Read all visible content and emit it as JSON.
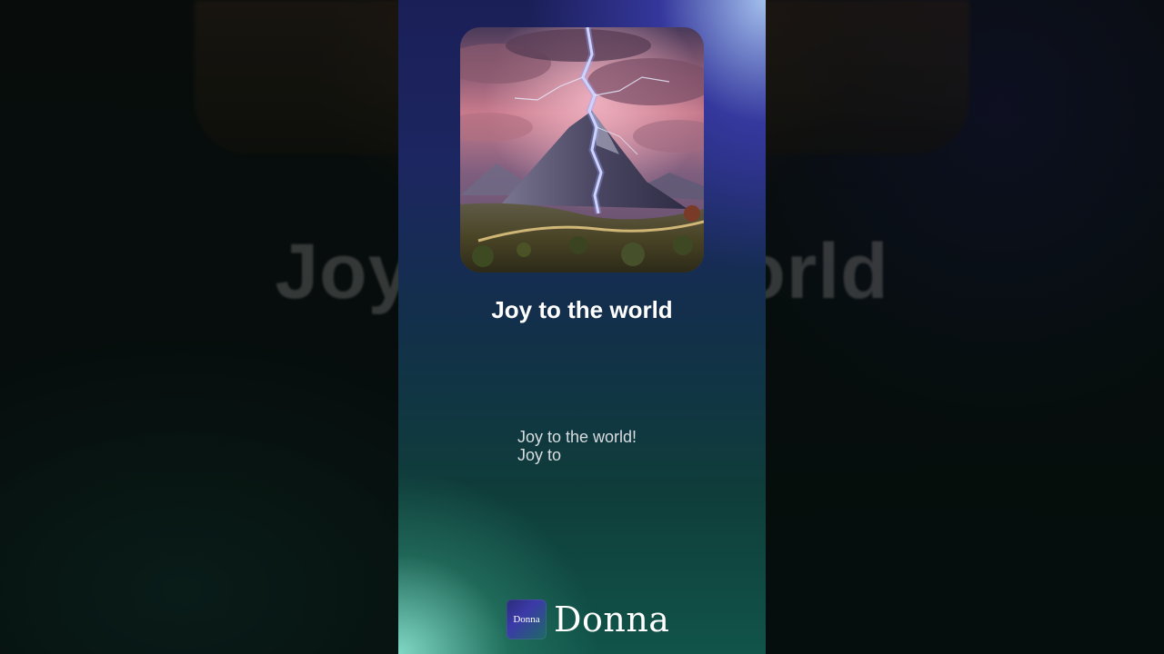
{
  "song": {
    "title": "Joy to the world",
    "background_title": "Joy to the world"
  },
  "lyrics": {
    "lines": [
      "Joy to the world!",
      "Joy to"
    ]
  },
  "brand": {
    "logo_text": "Donna",
    "name": "Donna"
  },
  "cover_art": {
    "icon": "mountain-lightning-artwork"
  },
  "colors": {
    "panel_top": "#1b1f58",
    "panel_bottom": "#115449",
    "accent_glow_top_right": "#aac8f5",
    "accent_glow_bottom_left": "#8ce6d2",
    "title_text": "#ffffff",
    "lyric_text": "#d9dde0"
  }
}
